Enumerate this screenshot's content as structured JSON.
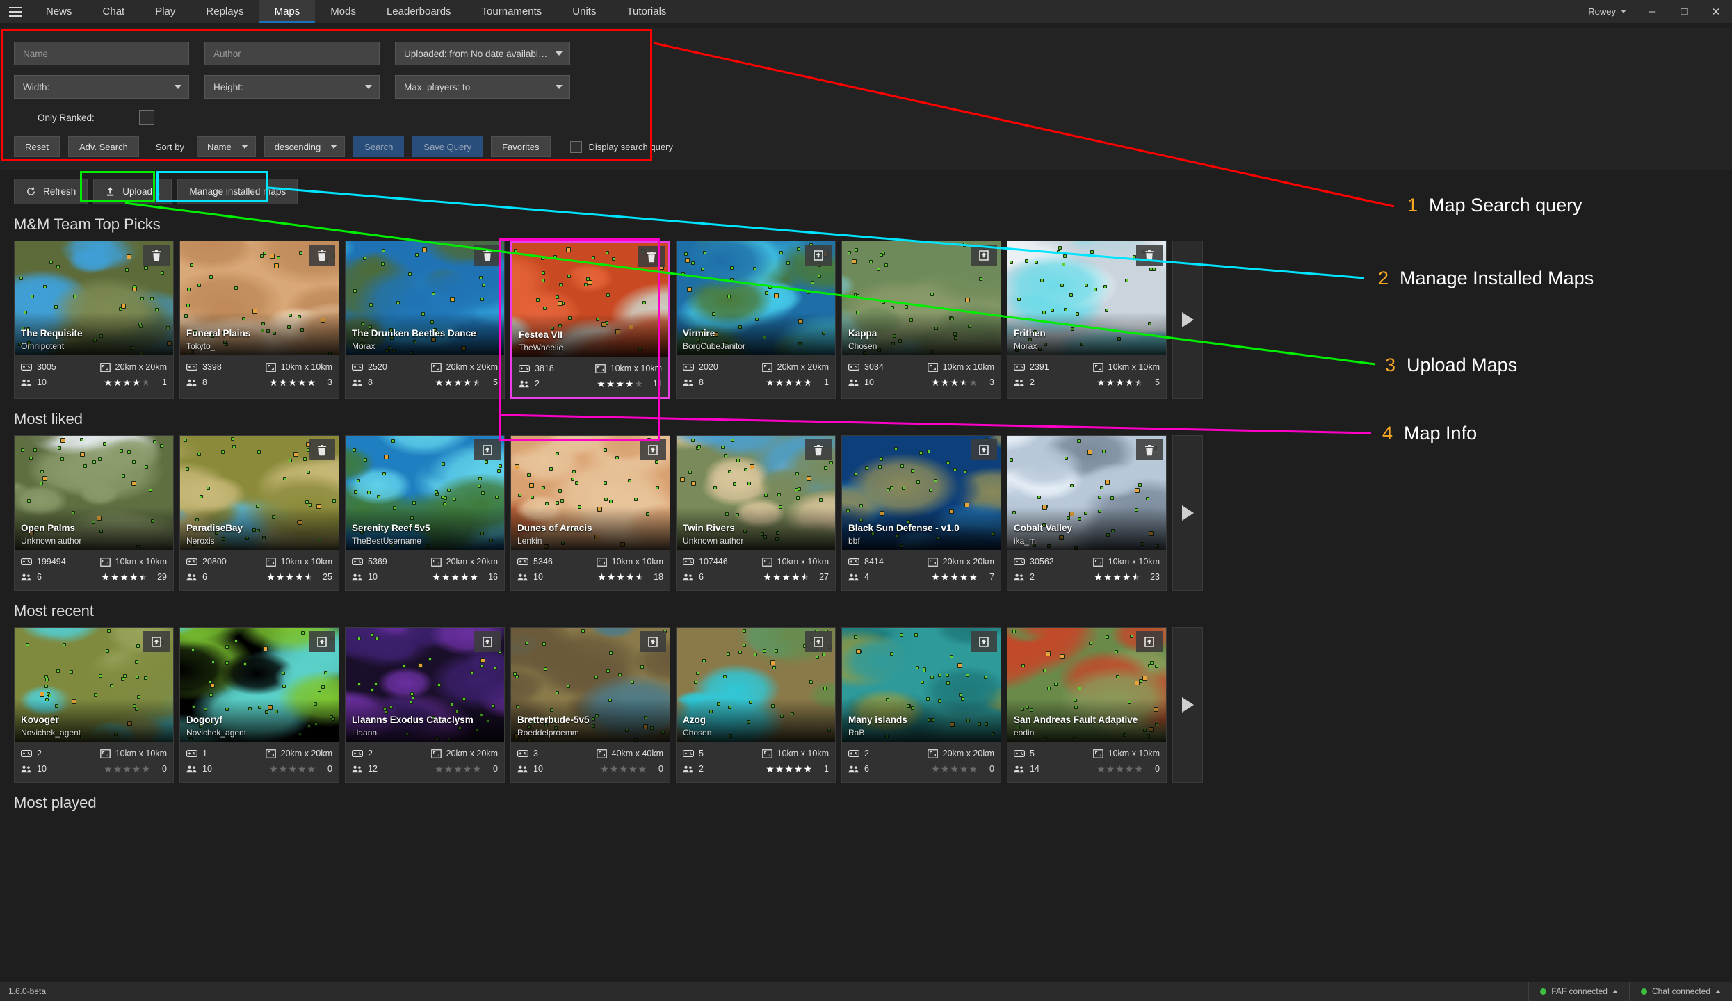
{
  "menubar": {
    "hamburger_icon": "hamburger-icon",
    "tabs": [
      {
        "label": "News",
        "active": false
      },
      {
        "label": "Chat",
        "active": false
      },
      {
        "label": "Play",
        "active": false
      },
      {
        "label": "Replays",
        "active": false
      },
      {
        "label": "Maps",
        "active": true
      },
      {
        "label": "Mods",
        "active": false
      },
      {
        "label": "Leaderboards",
        "active": false
      },
      {
        "label": "Tournaments",
        "active": false
      },
      {
        "label": "Units",
        "active": false
      },
      {
        "label": "Tutorials",
        "active": false
      }
    ],
    "user": "Rowey",
    "window_buttons": {
      "minimize": "–",
      "maximize": "□",
      "close": "✕"
    }
  },
  "search": {
    "name_placeholder": "Name",
    "author_placeholder": "Author",
    "uploaded_label": "Uploaded: from No date available to N...",
    "width_label": "Width:",
    "height_label": "Height:",
    "maxplayers_label": "Max. players:  to",
    "only_ranked_label": "Only Ranked:",
    "only_ranked_checked": false,
    "reset_label": "Reset",
    "adv_search_label": "Adv. Search",
    "sort_by_label": "Sort by",
    "sort_field": "Name",
    "sort_order": "descending",
    "search_label": "Search",
    "save_query_label": "Save Query",
    "favorites_label": "Favorites",
    "display_query_label": "Display search query",
    "display_query_checked": false
  },
  "toolbar": {
    "refresh_label": "Refresh",
    "refresh_icon": "refresh-icon",
    "upload_label": "Upload...",
    "upload_icon": "upload-icon",
    "manage_label": "Manage installed maps"
  },
  "sections": [
    {
      "title": "M&M Team Top Picks",
      "cards": [
        {
          "name": "The Requisite",
          "author": "Omnipotent",
          "downloads": "3005",
          "size": "20km x 20km",
          "players": "10",
          "stars": 4,
          "half": false,
          "ratings": "1",
          "action": "trash-icon",
          "art": "green-river",
          "selected": false
        },
        {
          "name": "Funeral Plains",
          "author": "Tokyto_",
          "downloads": "3398",
          "size": "10km x 10km",
          "players": "8",
          "stars": 5,
          "half": false,
          "ratings": "3",
          "action": "trash-icon",
          "art": "desert-pale",
          "selected": false
        },
        {
          "name": "The Drunken Beetles Dance",
          "author": "Morax",
          "downloads": "2520",
          "size": "20km x 20km",
          "players": "8",
          "stars": 4,
          "half": true,
          "ratings": "5",
          "action": "trash-icon",
          "art": "blue-lagoon",
          "selected": false
        },
        {
          "name": "Festea VII",
          "author": "TheWheelie",
          "downloads": "3818",
          "size": "10km x 10km",
          "players": "2",
          "stars": 4,
          "half": false,
          "ratings": "11",
          "action": "trash-icon",
          "art": "red-canyon",
          "selected": true
        },
        {
          "name": "Virmire",
          "author": "BorgCubeJanitor",
          "downloads": "2020",
          "size": "20km x 20km",
          "players": "8",
          "stars": 5,
          "half": false,
          "ratings": "1",
          "action": "download-icon",
          "art": "cyan-islands",
          "selected": false
        },
        {
          "name": "Kappa",
          "author": "Chosen",
          "downloads": "3034",
          "size": "10km x 10km",
          "players": "10",
          "stars": 3,
          "half": true,
          "ratings": "3",
          "action": "download-icon",
          "art": "teal-terrain",
          "selected": false
        },
        {
          "name": "Frithen",
          "author": "Morax",
          "downloads": "2391",
          "size": "10km x 10km",
          "players": "2",
          "stars": 4,
          "half": true,
          "ratings": "5",
          "action": "trash-icon",
          "art": "snow-white",
          "selected": false
        }
      ]
    },
    {
      "title": "Most liked",
      "cards": [
        {
          "name": "Open Palms",
          "author": "Unknown author",
          "downloads": "199494",
          "size": "10km x 10km",
          "players": "6",
          "stars": 4,
          "half": true,
          "ratings": "29",
          "action": "none",
          "art": "green-tundra",
          "selected": false
        },
        {
          "name": "ParadiseBay",
          "author": "Neroxis",
          "downloads": "20800",
          "size": "10km x 10km",
          "players": "6",
          "stars": 4,
          "half": true,
          "ratings": "25",
          "action": "trash-icon",
          "art": "olive-bay",
          "selected": false
        },
        {
          "name": "Serenity Reef 5v5",
          "author": "TheBestUsername",
          "downloads": "5369",
          "size": "20km x 20km",
          "players": "10",
          "stars": 5,
          "half": false,
          "ratings": "16",
          "action": "download-icon",
          "art": "reef-blue",
          "selected": false
        },
        {
          "name": "Dunes of Arracis",
          "author": "Lenkin",
          "downloads": "5346",
          "size": "10km x 10km",
          "players": "10",
          "stars": 4,
          "half": true,
          "ratings": "18",
          "action": "download-icon",
          "art": "sand-dunes",
          "selected": false
        },
        {
          "name": "Twin Rivers",
          "author": "Unknown author",
          "downloads": "107446",
          "size": "10km x 10km",
          "players": "6",
          "stars": 4,
          "half": true,
          "ratings": "27",
          "action": "trash-icon",
          "art": "twin-rivers",
          "selected": false
        },
        {
          "name": "Black Sun Defense - v1.0",
          "author": "bbf",
          "downloads": "8414",
          "size": "20km x 20km",
          "players": "4",
          "stars": 5,
          "half": false,
          "ratings": "7",
          "action": "download-icon",
          "art": "deep-ocean",
          "selected": false
        },
        {
          "name": "Cobalt Valley",
          "author": "ika_m",
          "downloads": "30562",
          "size": "10km x 10km",
          "players": "2",
          "stars": 4,
          "half": true,
          "ratings": "23",
          "action": "trash-icon",
          "art": "ice-valley",
          "selected": false
        }
      ]
    },
    {
      "title": "Most recent",
      "cards": [
        {
          "name": "Kovoger",
          "author": "Novichek_agent",
          "downloads": "2",
          "size": "10km x 10km",
          "players": "10",
          "stars": 0,
          "half": false,
          "ratings": "0",
          "action": "download-icon",
          "art": "olive-plain",
          "selected": false
        },
        {
          "name": "Dogoryf",
          "author": "Novichek_agent",
          "downloads": "1",
          "size": "20km x 20km",
          "players": "10",
          "stars": 0,
          "half": false,
          "ratings": "0",
          "action": "download-icon",
          "art": "green-strip",
          "selected": false
        },
        {
          "name": "Llaanns Exodus Cataclysm",
          "author": "Llaann",
          "downloads": "2",
          "size": "20km x 20km",
          "players": "12",
          "stars": 0,
          "half": false,
          "ratings": "0",
          "action": "download-icon",
          "art": "purple-void",
          "selected": false
        },
        {
          "name": "Bretterbude-5v5",
          "author": "Roeddelproemm",
          "downloads": "3",
          "size": "40km x 40km",
          "players": "10",
          "stars": 0,
          "half": false,
          "ratings": "0",
          "action": "download-icon",
          "art": "brown-maze",
          "selected": false
        },
        {
          "name": "Azog",
          "author": "Chosen",
          "downloads": "5",
          "size": "10km x 10km",
          "players": "2",
          "stars": 5,
          "half": false,
          "ratings": "1",
          "action": "download-icon",
          "art": "azure-pool",
          "selected": false
        },
        {
          "name": "Many islands",
          "author": "RaB",
          "downloads": "2",
          "size": "20km x 20km",
          "players": "6",
          "stars": 0,
          "half": false,
          "ratings": "0",
          "action": "download-icon",
          "art": "many-islands",
          "selected": false
        },
        {
          "name": "San Andreas Fault Adaptive",
          "author": "eodin",
          "downloads": "5",
          "size": "10km x 10km",
          "players": "14",
          "stars": 0,
          "half": false,
          "ratings": "0",
          "action": "download-icon",
          "art": "fault-red",
          "selected": false
        }
      ]
    },
    {
      "title": "Most played",
      "cards": []
    }
  ],
  "annotations": {
    "colors": {
      "search_query": "#ff0000",
      "manage_maps": "#00e5ff",
      "upload_maps": "#00ee00",
      "map_info": "#ff00c8",
      "number": "#f5a623"
    },
    "items": [
      {
        "num": "1",
        "text": "Map Search query"
      },
      {
        "num": "2",
        "text": "Manage Installed Maps"
      },
      {
        "num": "3",
        "text": "Upload Maps"
      },
      {
        "num": "4",
        "text": "Map Info"
      }
    ]
  },
  "statusbar": {
    "version": "1.6.0-beta",
    "faf_status": "FAF connected",
    "chat_status": "Chat connected"
  }
}
